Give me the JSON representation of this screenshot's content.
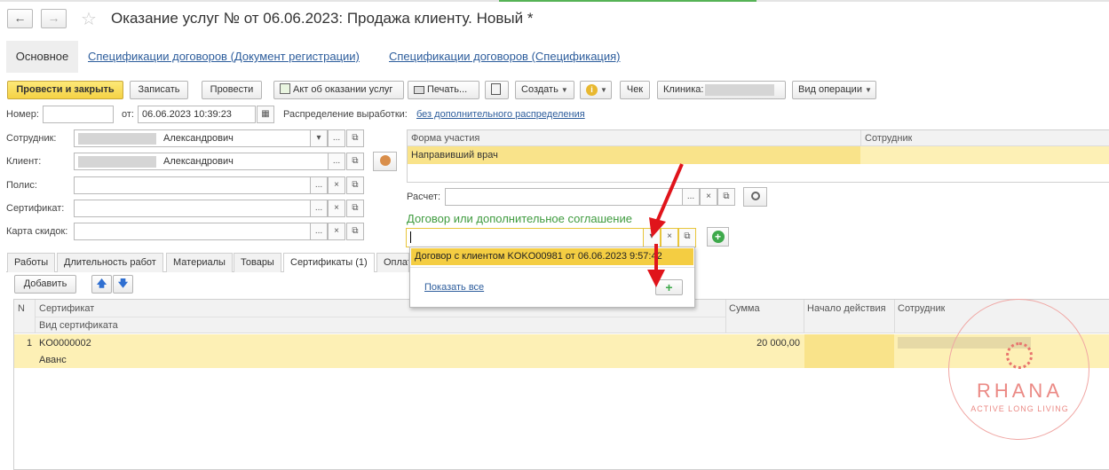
{
  "nav": {
    "back_icon": "arrow-left-icon",
    "forward_icon": "arrow-right-icon",
    "favorite_icon": "star-icon"
  },
  "window": {
    "title": "Оказание услуг №  от 06.06.2023: Продажа клиенту.  Новый *"
  },
  "top_tabs": {
    "main": "Основное",
    "link1": "Спецификации договоров (Документ регистрации)",
    "link2": "Спецификации договоров (Спецификация)"
  },
  "toolbar": {
    "post_close": "Провести и закрыть",
    "save": "Записать",
    "post": "Провести",
    "act": "Акт об оказании услуг",
    "print": "Печать...",
    "create": "Создать",
    "check": "Чек",
    "clinic": "Клиника:",
    "operation": "Вид операции"
  },
  "header_fields": {
    "number_label": "Номер:",
    "number_value": "",
    "from_label": "от:",
    "date_value": "06.06.2023 10:39:23",
    "distribution_label": "Распределение выработки:",
    "distribution_value": "без дополнительного распределения"
  },
  "left_form": {
    "employee_label": "Сотрудник:",
    "employee_value": "Александрович",
    "client_label": "Клиент:",
    "client_value": "Александрович",
    "policy_label": "Полис:",
    "certificate_label": "Сертификат:",
    "discount_label": "Карта скидок:"
  },
  "participation_table": {
    "col1": "Форма участия",
    "col2": "Сотрудник",
    "row1_col1": "Направивший врач",
    "row1_col2": ""
  },
  "calculation": {
    "label": "Расчет:",
    "value": ""
  },
  "contract_section": {
    "title": "Договор или дополнительное соглашение",
    "value": ""
  },
  "dropdown": {
    "item": "Договор с клиентом KOKO00981 от 06.06.2023 9:57:42",
    "show_all": "Показать все"
  },
  "lower_tabs": [
    "Работы",
    "Длительность работ",
    "Материалы",
    "Товары",
    "Сертификаты (1)",
    "Оплата"
  ],
  "certs_toolbar": {
    "add": "Добавить"
  },
  "certs_table": {
    "headers": {
      "n": "N",
      "certificate": "Сертификат",
      "certificate_type": "Вид сертификата",
      "sum": "Сумма",
      "start": "Начало действия",
      "employee": "Сотрудник"
    },
    "rows": [
      {
        "n": "1",
        "certificate": "KO0000002",
        "type": "Аванс",
        "sum": "20 000,00",
        "start": "",
        "employee": ""
      }
    ]
  },
  "watermark": {
    "brand": "RHANA",
    "tagline": "ACTIVE LONG LIVING"
  },
  "colors": {
    "accent_yellow": "#f5d245",
    "row_highlight": "#fdf0b5",
    "link_blue": "#2d5d9c",
    "section_green": "#3e9b3e",
    "arrow_red": "#e0141b"
  }
}
